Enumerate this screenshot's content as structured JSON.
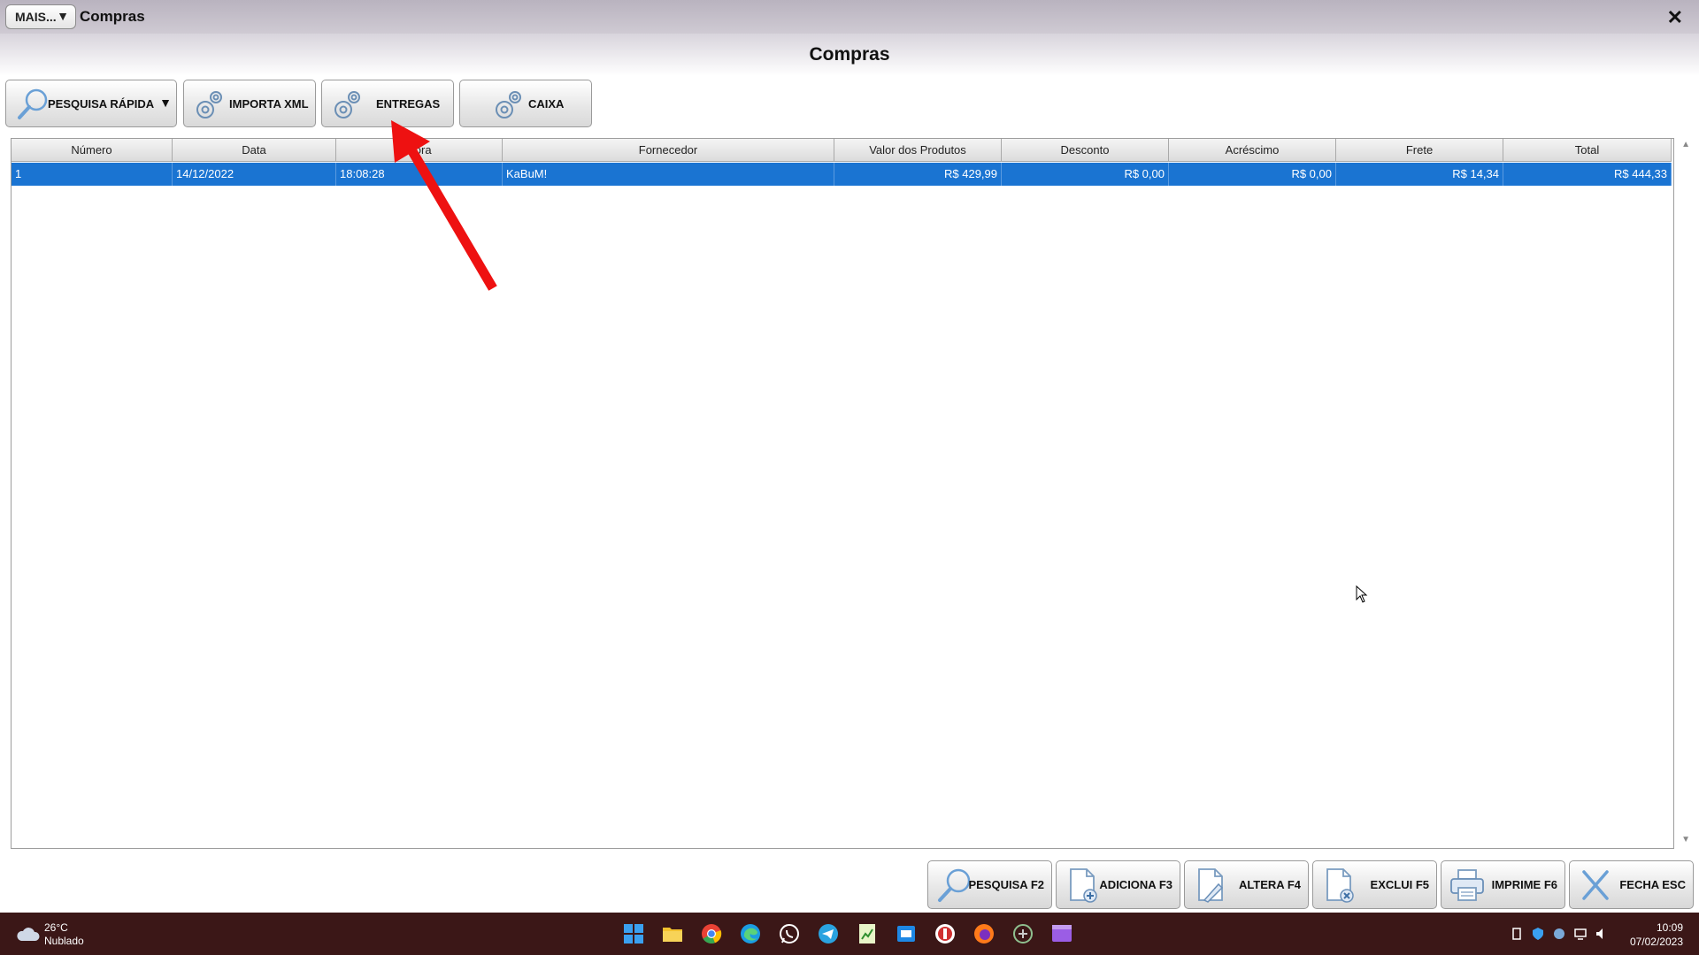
{
  "window": {
    "menu_label": "MAIS...",
    "title": "Compras",
    "close_glyph": "✕"
  },
  "page": {
    "title": "Compras"
  },
  "toolbar": {
    "buttons": [
      {
        "label": "PESQUISA RÁPIDA",
        "icon": "magnifier-icon"
      },
      {
        "label": "IMPORTA XML",
        "icon": "gear-icon"
      },
      {
        "label": "ENTREGAS",
        "icon": "gear-icon"
      },
      {
        "label": "CAIXA",
        "icon": "gear-icon"
      }
    ]
  },
  "grid": {
    "columns": [
      "Número",
      "Data",
      "Hora",
      "Fornecedor",
      "Valor dos Produtos",
      "Desconto",
      "Acréscimo",
      "Frete",
      "Total"
    ],
    "rows": [
      [
        "1",
        "14/12/2022",
        "18:08:28",
        "KaBuM!",
        "R$ 429,99",
        "R$ 0,00",
        "R$ 0,00",
        "R$ 14,34",
        "R$ 444,33"
      ]
    ],
    "selected_row_color": "#1a74d2"
  },
  "bottom_buttons": [
    {
      "label": "PESQUISA F2",
      "icon": "magnifier-icon"
    },
    {
      "label": "ADICIONA F3",
      "icon": "document-add-icon"
    },
    {
      "label": "ALTERA F4",
      "icon": "document-edit-icon"
    },
    {
      "label": "EXCLUI F5",
      "icon": "document-delete-icon"
    },
    {
      "label": "IMPRIME F6",
      "icon": "printer-icon"
    },
    {
      "label": "FECHA ESC",
      "icon": "close-icon"
    }
  ],
  "annotation": {
    "color": "#ee1111",
    "points_to": "ENTREGAS"
  },
  "taskbar": {
    "weather_temp": "26°C",
    "weather_condition": "Nublado",
    "time": "10:09",
    "date": "07/02/2023",
    "apps": [
      "windows-start-icon",
      "file-explorer-icon",
      "chrome-icon",
      "edge-icon",
      "whatsapp-icon",
      "telegram-icon",
      "spreadsheet-icon",
      "outlook-icon",
      "app-icon",
      "firefox-icon",
      "erp-app-icon",
      "media-app-icon"
    ]
  }
}
